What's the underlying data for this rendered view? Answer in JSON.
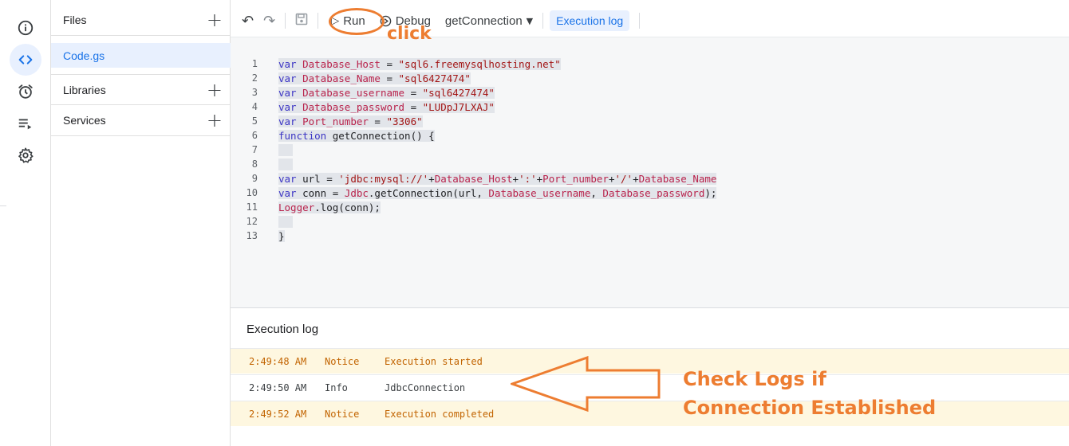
{
  "rail": {
    "items": [
      "overview-icon",
      "editor-icon",
      "triggers-icon",
      "executions-icon",
      "settings-icon"
    ],
    "active_color": "#1a73e8"
  },
  "files_panel": {
    "files_title": "Files",
    "file_name": "Code.gs",
    "libraries_title": "Libraries",
    "services_title": "Services"
  },
  "toolbar": {
    "run_label": "Run",
    "debug_label": "Debug",
    "function_name": "getConnection",
    "exec_log_label": "Execution log"
  },
  "editor": {
    "lines": [
      {
        "n": "1",
        "tokens": [
          {
            "t": "var ",
            "c": "kw"
          },
          {
            "t": "Database_Host",
            "c": "vn"
          },
          {
            "t": " = ",
            "c": ""
          },
          {
            "t": "\"sql6.freemysqlhosting.net\"",
            "c": "st"
          }
        ]
      },
      {
        "n": "2",
        "tokens": [
          {
            "t": "var ",
            "c": "kw"
          },
          {
            "t": "Database_Name",
            "c": "vn"
          },
          {
            "t": " = ",
            "c": ""
          },
          {
            "t": "\"sql6427474\"",
            "c": "st"
          }
        ]
      },
      {
        "n": "3",
        "tokens": [
          {
            "t": "var ",
            "c": "kw"
          },
          {
            "t": "Database_username",
            "c": "vn"
          },
          {
            "t": " = ",
            "c": ""
          },
          {
            "t": "\"sql6427474\"",
            "c": "st"
          }
        ]
      },
      {
        "n": "4",
        "tokens": [
          {
            "t": "var ",
            "c": "kw"
          },
          {
            "t": "Database_password",
            "c": "vn"
          },
          {
            "t": " = ",
            "c": ""
          },
          {
            "t": "\"LUDpJ7LXAJ\"",
            "c": "st"
          }
        ]
      },
      {
        "n": "5",
        "tokens": [
          {
            "t": "var ",
            "c": "kw"
          },
          {
            "t": "Port_number",
            "c": "vn"
          },
          {
            "t": " = ",
            "c": ""
          },
          {
            "t": "\"3306\"",
            "c": "st"
          }
        ]
      },
      {
        "n": "6",
        "tokens": [
          {
            "t": "function ",
            "c": "kw"
          },
          {
            "t": "getConnection() {",
            "c": ""
          }
        ]
      },
      {
        "n": "7",
        "tokens": []
      },
      {
        "n": "8",
        "tokens": []
      },
      {
        "n": "9",
        "tokens": [
          {
            "t": "var ",
            "c": "kw"
          },
          {
            "t": "url = ",
            "c": ""
          },
          {
            "t": "'jdbc:mysql://'",
            "c": "st"
          },
          {
            "t": "+",
            "c": ""
          },
          {
            "t": "Database_Host",
            "c": "vn"
          },
          {
            "t": "+",
            "c": ""
          },
          {
            "t": "':'",
            "c": "st"
          },
          {
            "t": "+",
            "c": ""
          },
          {
            "t": "Port_number",
            "c": "vn"
          },
          {
            "t": "+",
            "c": ""
          },
          {
            "t": "'/'",
            "c": "st"
          },
          {
            "t": "+",
            "c": ""
          },
          {
            "t": "Database_Name",
            "c": "vn"
          }
        ]
      },
      {
        "n": "10",
        "tokens": [
          {
            "t": "var ",
            "c": "kw"
          },
          {
            "t": "conn = ",
            "c": ""
          },
          {
            "t": "Jdbc",
            "c": "vn"
          },
          {
            "t": ".getConnection(url, ",
            "c": ""
          },
          {
            "t": "Database_username",
            "c": "vn"
          },
          {
            "t": ", ",
            "c": ""
          },
          {
            "t": "Database_password",
            "c": "vn"
          },
          {
            "t": ");",
            "c": ""
          }
        ]
      },
      {
        "n": "11",
        "tokens": [
          {
            "t": "Logger",
            "c": "vn"
          },
          {
            "t": ".log(conn);",
            "c": ""
          }
        ]
      },
      {
        "n": "12",
        "tokens": []
      },
      {
        "n": "13",
        "tokens": [
          {
            "t": "}",
            "c": ""
          }
        ]
      }
    ]
  },
  "log": {
    "title": "Execution log",
    "rows": [
      {
        "time": "2:49:48 AM",
        "level": "Notice",
        "message": "Execution started"
      },
      {
        "time": "2:49:50 AM",
        "level": "Info",
        "message": "JdbcConnection"
      },
      {
        "time": "2:49:52 AM",
        "level": "Notice",
        "message": "Execution completed"
      }
    ]
  },
  "annotations": {
    "click_text": "click",
    "check_text_line1": "Check Logs if",
    "check_text_line2": "Connection Established",
    "color": "#ed7d31"
  }
}
